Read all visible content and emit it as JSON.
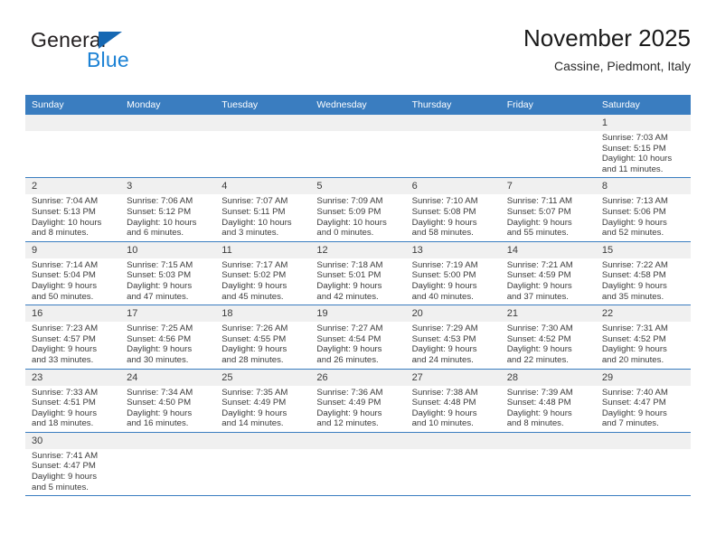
{
  "brand": {
    "name_part1": "General",
    "name_part2": "Blue",
    "triangle_icon": "triangle-icon",
    "colors": {
      "dark": "#231f20",
      "blue": "#1b81d4",
      "triangle": "#1668b3"
    }
  },
  "header": {
    "title": "November 2025",
    "subtitle": "Cassine, Piedmont, Italy"
  },
  "theme": {
    "header_blue": "#3a7dc0",
    "daynum_band": "#f0f0f0",
    "text": "#3b3b3b"
  },
  "weekday_headers": [
    "Sunday",
    "Monday",
    "Tuesday",
    "Wednesday",
    "Thursday",
    "Friday",
    "Saturday"
  ],
  "weeks": [
    [
      {
        "day": "",
        "sunrise": "",
        "sunset": "",
        "daylight_line1": "",
        "daylight_line2": ""
      },
      {
        "day": "",
        "sunrise": "",
        "sunset": "",
        "daylight_line1": "",
        "daylight_line2": ""
      },
      {
        "day": "",
        "sunrise": "",
        "sunset": "",
        "daylight_line1": "",
        "daylight_line2": ""
      },
      {
        "day": "",
        "sunrise": "",
        "sunset": "",
        "daylight_line1": "",
        "daylight_line2": ""
      },
      {
        "day": "",
        "sunrise": "",
        "sunset": "",
        "daylight_line1": "",
        "daylight_line2": ""
      },
      {
        "day": "",
        "sunrise": "",
        "sunset": "",
        "daylight_line1": "",
        "daylight_line2": ""
      },
      {
        "day": "1",
        "sunrise": "Sunrise: 7:03 AM",
        "sunset": "Sunset: 5:15 PM",
        "daylight_line1": "Daylight: 10 hours",
        "daylight_line2": "and 11 minutes."
      }
    ],
    [
      {
        "day": "2",
        "sunrise": "Sunrise: 7:04 AM",
        "sunset": "Sunset: 5:13 PM",
        "daylight_line1": "Daylight: 10 hours",
        "daylight_line2": "and 8 minutes."
      },
      {
        "day": "3",
        "sunrise": "Sunrise: 7:06 AM",
        "sunset": "Sunset: 5:12 PM",
        "daylight_line1": "Daylight: 10 hours",
        "daylight_line2": "and 6 minutes."
      },
      {
        "day": "4",
        "sunrise": "Sunrise: 7:07 AM",
        "sunset": "Sunset: 5:11 PM",
        "daylight_line1": "Daylight: 10 hours",
        "daylight_line2": "and 3 minutes."
      },
      {
        "day": "5",
        "sunrise": "Sunrise: 7:09 AM",
        "sunset": "Sunset: 5:09 PM",
        "daylight_line1": "Daylight: 10 hours",
        "daylight_line2": "and 0 minutes."
      },
      {
        "day": "6",
        "sunrise": "Sunrise: 7:10 AM",
        "sunset": "Sunset: 5:08 PM",
        "daylight_line1": "Daylight: 9 hours",
        "daylight_line2": "and 58 minutes."
      },
      {
        "day": "7",
        "sunrise": "Sunrise: 7:11 AM",
        "sunset": "Sunset: 5:07 PM",
        "daylight_line1": "Daylight: 9 hours",
        "daylight_line2": "and 55 minutes."
      },
      {
        "day": "8",
        "sunrise": "Sunrise: 7:13 AM",
        "sunset": "Sunset: 5:06 PM",
        "daylight_line1": "Daylight: 9 hours",
        "daylight_line2": "and 52 minutes."
      }
    ],
    [
      {
        "day": "9",
        "sunrise": "Sunrise: 7:14 AM",
        "sunset": "Sunset: 5:04 PM",
        "daylight_line1": "Daylight: 9 hours",
        "daylight_line2": "and 50 minutes."
      },
      {
        "day": "10",
        "sunrise": "Sunrise: 7:15 AM",
        "sunset": "Sunset: 5:03 PM",
        "daylight_line1": "Daylight: 9 hours",
        "daylight_line2": "and 47 minutes."
      },
      {
        "day": "11",
        "sunrise": "Sunrise: 7:17 AM",
        "sunset": "Sunset: 5:02 PM",
        "daylight_line1": "Daylight: 9 hours",
        "daylight_line2": "and 45 minutes."
      },
      {
        "day": "12",
        "sunrise": "Sunrise: 7:18 AM",
        "sunset": "Sunset: 5:01 PM",
        "daylight_line1": "Daylight: 9 hours",
        "daylight_line2": "and 42 minutes."
      },
      {
        "day": "13",
        "sunrise": "Sunrise: 7:19 AM",
        "sunset": "Sunset: 5:00 PM",
        "daylight_line1": "Daylight: 9 hours",
        "daylight_line2": "and 40 minutes."
      },
      {
        "day": "14",
        "sunrise": "Sunrise: 7:21 AM",
        "sunset": "Sunset: 4:59 PM",
        "daylight_line1": "Daylight: 9 hours",
        "daylight_line2": "and 37 minutes."
      },
      {
        "day": "15",
        "sunrise": "Sunrise: 7:22 AM",
        "sunset": "Sunset: 4:58 PM",
        "daylight_line1": "Daylight: 9 hours",
        "daylight_line2": "and 35 minutes."
      }
    ],
    [
      {
        "day": "16",
        "sunrise": "Sunrise: 7:23 AM",
        "sunset": "Sunset: 4:57 PM",
        "daylight_line1": "Daylight: 9 hours",
        "daylight_line2": "and 33 minutes."
      },
      {
        "day": "17",
        "sunrise": "Sunrise: 7:25 AM",
        "sunset": "Sunset: 4:56 PM",
        "daylight_line1": "Daylight: 9 hours",
        "daylight_line2": "and 30 minutes."
      },
      {
        "day": "18",
        "sunrise": "Sunrise: 7:26 AM",
        "sunset": "Sunset: 4:55 PM",
        "daylight_line1": "Daylight: 9 hours",
        "daylight_line2": "and 28 minutes."
      },
      {
        "day": "19",
        "sunrise": "Sunrise: 7:27 AM",
        "sunset": "Sunset: 4:54 PM",
        "daylight_line1": "Daylight: 9 hours",
        "daylight_line2": "and 26 minutes."
      },
      {
        "day": "20",
        "sunrise": "Sunrise: 7:29 AM",
        "sunset": "Sunset: 4:53 PM",
        "daylight_line1": "Daylight: 9 hours",
        "daylight_line2": "and 24 minutes."
      },
      {
        "day": "21",
        "sunrise": "Sunrise: 7:30 AM",
        "sunset": "Sunset: 4:52 PM",
        "daylight_line1": "Daylight: 9 hours",
        "daylight_line2": "and 22 minutes."
      },
      {
        "day": "22",
        "sunrise": "Sunrise: 7:31 AM",
        "sunset": "Sunset: 4:52 PM",
        "daylight_line1": "Daylight: 9 hours",
        "daylight_line2": "and 20 minutes."
      }
    ],
    [
      {
        "day": "23",
        "sunrise": "Sunrise: 7:33 AM",
        "sunset": "Sunset: 4:51 PM",
        "daylight_line1": "Daylight: 9 hours",
        "daylight_line2": "and 18 minutes."
      },
      {
        "day": "24",
        "sunrise": "Sunrise: 7:34 AM",
        "sunset": "Sunset: 4:50 PM",
        "daylight_line1": "Daylight: 9 hours",
        "daylight_line2": "and 16 minutes."
      },
      {
        "day": "25",
        "sunrise": "Sunrise: 7:35 AM",
        "sunset": "Sunset: 4:49 PM",
        "daylight_line1": "Daylight: 9 hours",
        "daylight_line2": "and 14 minutes."
      },
      {
        "day": "26",
        "sunrise": "Sunrise: 7:36 AM",
        "sunset": "Sunset: 4:49 PM",
        "daylight_line1": "Daylight: 9 hours",
        "daylight_line2": "and 12 minutes."
      },
      {
        "day": "27",
        "sunrise": "Sunrise: 7:38 AM",
        "sunset": "Sunset: 4:48 PM",
        "daylight_line1": "Daylight: 9 hours",
        "daylight_line2": "and 10 minutes."
      },
      {
        "day": "28",
        "sunrise": "Sunrise: 7:39 AM",
        "sunset": "Sunset: 4:48 PM",
        "daylight_line1": "Daylight: 9 hours",
        "daylight_line2": "and 8 minutes."
      },
      {
        "day": "29",
        "sunrise": "Sunrise: 7:40 AM",
        "sunset": "Sunset: 4:47 PM",
        "daylight_line1": "Daylight: 9 hours",
        "daylight_line2": "and 7 minutes."
      }
    ],
    [
      {
        "day": "30",
        "sunrise": "Sunrise: 7:41 AM",
        "sunset": "Sunset: 4:47 PM",
        "daylight_line1": "Daylight: 9 hours",
        "daylight_line2": "and 5 minutes."
      },
      {
        "day": "",
        "sunrise": "",
        "sunset": "",
        "daylight_line1": "",
        "daylight_line2": ""
      },
      {
        "day": "",
        "sunrise": "",
        "sunset": "",
        "daylight_line1": "",
        "daylight_line2": ""
      },
      {
        "day": "",
        "sunrise": "",
        "sunset": "",
        "daylight_line1": "",
        "daylight_line2": ""
      },
      {
        "day": "",
        "sunrise": "",
        "sunset": "",
        "daylight_line1": "",
        "daylight_line2": ""
      },
      {
        "day": "",
        "sunrise": "",
        "sunset": "",
        "daylight_line1": "",
        "daylight_line2": ""
      },
      {
        "day": "",
        "sunrise": "",
        "sunset": "",
        "daylight_line1": "",
        "daylight_line2": ""
      }
    ]
  ]
}
